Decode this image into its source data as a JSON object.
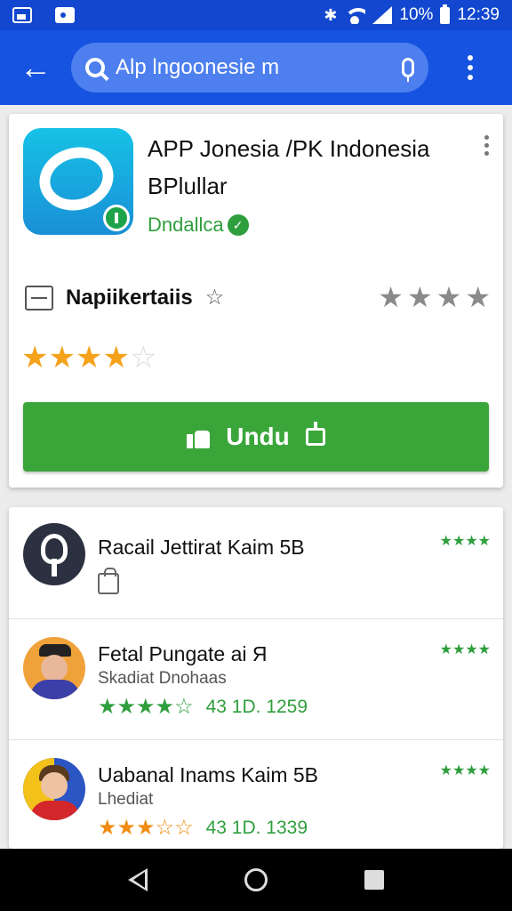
{
  "status_bar": {
    "battery_text": "10%",
    "time": "12:39"
  },
  "app_bar": {
    "search_query": "Alp lngoonesie m"
  },
  "app": {
    "title": "APP Jonesia /PK Indonesia BPlullar",
    "developer": "Dndallca",
    "category": "Napiikertaiis",
    "rating_stars": 4,
    "install_label": "Undu"
  },
  "list": [
    {
      "title": "Racail Jettirat Kaim 5B",
      "sub": "",
      "rating": "",
      "meta": ""
    },
    {
      "title": "Fetal Pungate ai Я",
      "sub": "Skadiat  Dnohaas",
      "meta": "43  1D. 1259"
    },
    {
      "title": "Uabanal Inams Kaim 5B",
      "sub": "Lhediat",
      "meta": "43  1D. 1339"
    }
  ],
  "colors": {
    "primary": "#1653e0",
    "status_bar": "#1347cf",
    "install": "#3aa63a",
    "developer_green": "#2f9e3d",
    "star_orange": "#f4a21c"
  },
  "icons": [
    "image-icon",
    "picture-icon",
    "bluetooth-icon",
    "wifi-icon",
    "signal-icon",
    "battery-icon",
    "back-arrow-icon",
    "search-icon",
    "mic-icon",
    "overflow-menu-icon",
    "verified-icon",
    "category-icon",
    "thumb-icon",
    "download-icon",
    "bag-icon",
    "nav-back-icon",
    "nav-home-icon",
    "nav-recents-icon"
  ]
}
